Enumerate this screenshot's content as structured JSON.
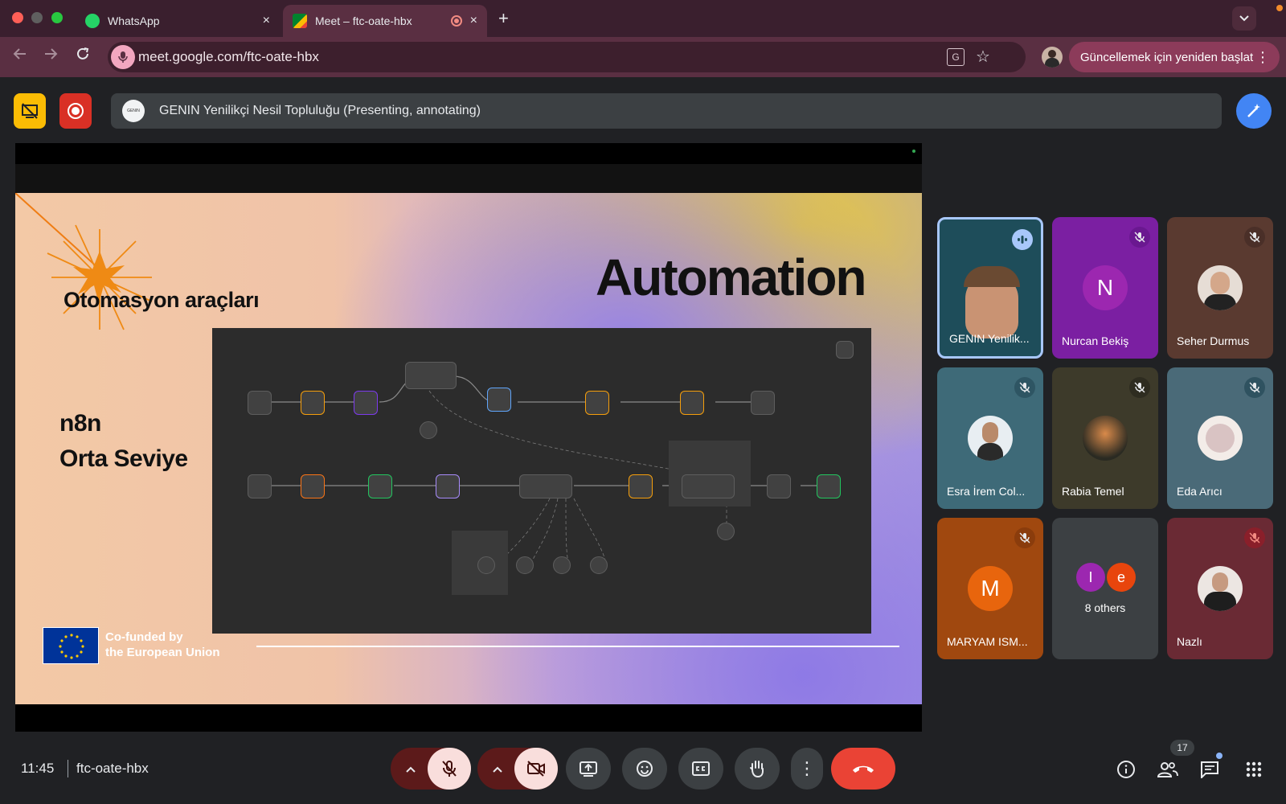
{
  "browser": {
    "tabs": [
      {
        "title": "WhatsApp",
        "close": "×"
      },
      {
        "title": "Meet – ftc-oate-hbx",
        "close": "×"
      }
    ],
    "new_tab": "+",
    "url": "meet.google.com/ftc-oate-hbx",
    "update_button": "Güncellemek için yeniden başlat"
  },
  "meet": {
    "presenter_label": "GENIN Yenilikçi Nesil Topluluğu (Presenting, annotating)",
    "slide": {
      "title": "Automation",
      "subtitle": "Otomasyon araçları",
      "left_line1": "n8n",
      "left_line2": "Orta Seviye",
      "eu_line1": "Co-funded by",
      "eu_line2": "the European Union"
    },
    "participants": [
      {
        "name": "GENIN Yenilik...",
        "color": "#1e4d5a"
      },
      {
        "name": "Nurcan Bekiş",
        "initial": "N",
        "color": "#7b1fa2",
        "avatar_color": "#9c27b0"
      },
      {
        "name": "Seher Durmus",
        "color": "#5a3a30"
      },
      {
        "name": "Esra İrem Col...",
        "color": "#3e6a78"
      },
      {
        "name": "Rabia Temel",
        "color": "#3d3a2a"
      },
      {
        "name": "Eda Arıcı",
        "color": "#4a6a78"
      },
      {
        "name": "MARYAM ISM...",
        "initial": "M",
        "color": "#a0480f",
        "avatar_color": "#e8650d"
      },
      {
        "name": "8 others",
        "initials": [
          "I",
          "e"
        ],
        "color": "#3c4043"
      },
      {
        "name": "Nazlı",
        "color": "#6a2a34"
      }
    ],
    "time": "11:45",
    "meeting_code": "ftc-oate-hbx",
    "people_count": "17"
  }
}
